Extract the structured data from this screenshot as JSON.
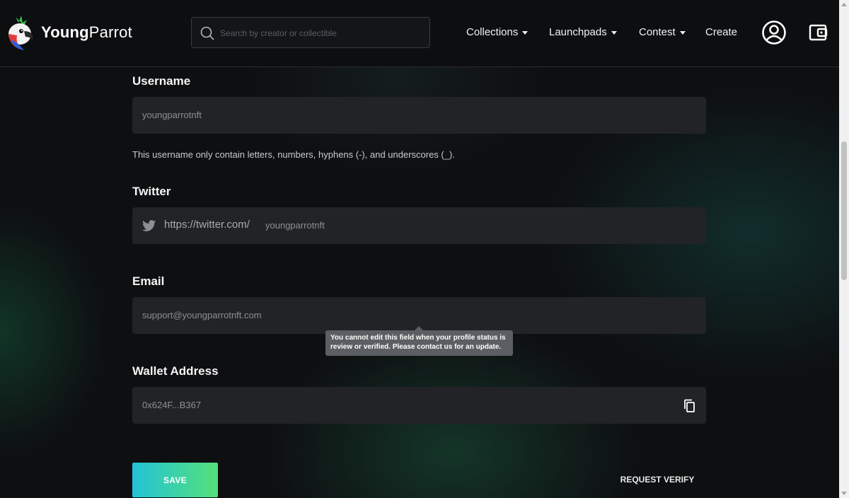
{
  "header": {
    "brand_bold": "Young",
    "brand_regular": "Parrot",
    "search_placeholder": "Search by creator or collectible",
    "nav": {
      "collections": "Collections",
      "launchpads": "Launchpads",
      "contest": "Contest",
      "create": "Create"
    },
    "icons": [
      "parrot-logo",
      "search-icon",
      "user-circle-icon",
      "wallet-icon"
    ]
  },
  "form": {
    "username": {
      "label": "Username",
      "value": "youngparrotnft",
      "hint": "This username only contain letters, numbers, hyphens (-), and underscores (_)."
    },
    "twitter": {
      "label": "Twitter",
      "prefix": "https://twitter.com/",
      "value": "youngparrotnft"
    },
    "email": {
      "label": "Email",
      "value": "support@youngparrotnft.com",
      "tooltip": "You cannot edit this field when your profile status is review or verified. Please contact us for an update."
    },
    "wallet": {
      "label": "Wallet Address",
      "value": "0x624F...B367"
    },
    "save_label": "SAVE",
    "request_verify_label": "REQUEST VERIFY"
  },
  "colors": {
    "background": "#0e0f11",
    "field_bg": "#222326",
    "accent_gradient_start": "#22c3d6",
    "accent_gradient_end": "#55e07a"
  }
}
